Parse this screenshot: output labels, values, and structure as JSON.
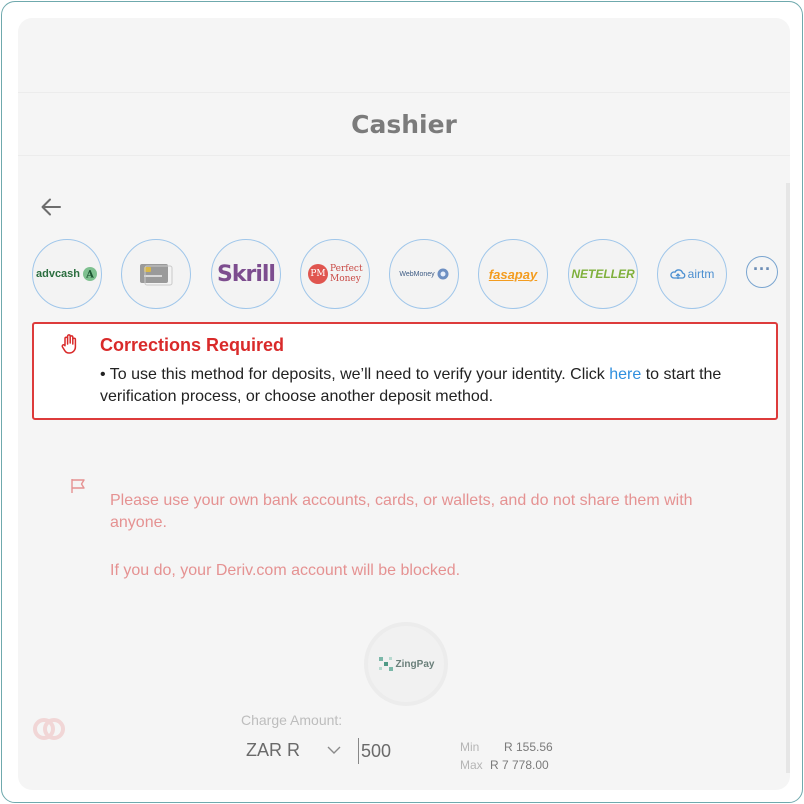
{
  "page": {
    "title": "Cashier"
  },
  "methods": [
    {
      "id": "advcash",
      "label": "advcash",
      "icon": "advcash-logo-icon"
    },
    {
      "id": "card",
      "label": "",
      "icon": "card-icon"
    },
    {
      "id": "skrill",
      "label": "Skrill",
      "icon": "skrill-logo-icon"
    },
    {
      "id": "perfect-money",
      "label": "Perfect Money",
      "badge": "PM",
      "icon": "perfect-money-logo-icon"
    },
    {
      "id": "webmoney",
      "label": "WebMoney",
      "icon": "webmoney-logo-icon"
    },
    {
      "id": "fasapay",
      "label": "fasapay",
      "icon": "fasapay-logo-icon"
    },
    {
      "id": "neteller",
      "label": "NETELLER",
      "icon": "neteller-logo-icon"
    },
    {
      "id": "airtm",
      "label": "airtm",
      "icon": "airtm-logo-icon"
    }
  ],
  "more_label": "···",
  "alert": {
    "title": "Corrections Required",
    "body_prefix": "• To use this method for deposits, we’ll need to verify your identity. Click ",
    "link_text": "here",
    "body_suffix": " to start the verification process, or choose another deposit method."
  },
  "warning": {
    "line1": "Please use your own bank accounts, cards, or wallets, and do not share them with anyone.",
    "line2": "If you do, your Deriv.com account will be blocked."
  },
  "provider": {
    "name": "ZingPay"
  },
  "charge": {
    "label": "Charge Amount:",
    "currency": "ZAR R",
    "amount": "500",
    "min_label": "Min",
    "min_value": "R 155.56",
    "max_label": "Max",
    "max_value": "R 7 778.00"
  },
  "colors": {
    "accent_border": "#6fa9ad",
    "error_red": "#dd3b3b",
    "warning_pink": "#e59292",
    "link_blue": "#2f8fde",
    "method_border": "#9fc6ea"
  }
}
